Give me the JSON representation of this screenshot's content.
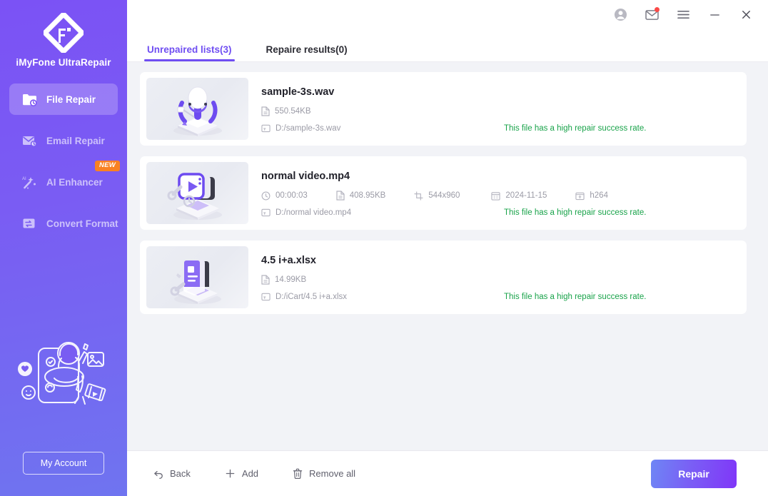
{
  "sidebar": {
    "brand": "iMyFone UltraRepair",
    "logo_icon": "diamond-logo-icon",
    "items": [
      {
        "label": "File Repair",
        "icon": "folder-repair-icon",
        "active": true,
        "badge": ""
      },
      {
        "label": "Email Repair",
        "icon": "mail-repair-icon",
        "active": false,
        "badge": ""
      },
      {
        "label": "AI Enhancer",
        "icon": "ai-wand-icon",
        "active": false,
        "badge": "NEW"
      },
      {
        "label": "Convert Format",
        "icon": "convert-icon",
        "active": false,
        "badge": ""
      }
    ],
    "account_button": "My Account",
    "illustration_icon": "person-photo-illustration"
  },
  "titlebar": {
    "buttons": [
      {
        "name": "account-icon",
        "glyph": "account"
      },
      {
        "name": "mail-icon",
        "glyph": "mail",
        "has_notification": true
      },
      {
        "name": "menu-icon",
        "glyph": "hamburger"
      },
      {
        "name": "minimize-icon",
        "glyph": "minimize"
      },
      {
        "name": "close-icon",
        "glyph": "close"
      }
    ]
  },
  "tabs": [
    {
      "label": "Unrepaired lists(3)",
      "active": true
    },
    {
      "label": "Repaire results(0)",
      "active": false
    }
  ],
  "files": [
    {
      "name": "sample-3s.wav",
      "thumb_icon": "microphone-3d-icon",
      "meta": [
        {
          "icon": "file-size-icon",
          "value": "550.54KB"
        }
      ],
      "path_icon": "folder-path-icon",
      "path": "D:/sample-3s.wav",
      "status": "This file has a high repair success rate."
    },
    {
      "name": "normal video.mp4",
      "thumb_icon": "video-player-3d-icon",
      "meta": [
        {
          "icon": "clock-icon",
          "value": "00:00:03"
        },
        {
          "icon": "file-size-icon",
          "value": "408.95KB"
        },
        {
          "icon": "resolution-icon",
          "value": "544x960"
        },
        {
          "icon": "calendar-icon",
          "value": "2024-11-15"
        },
        {
          "icon": "codec-icon",
          "value": "h264"
        }
      ],
      "path_icon": "folder-path-icon",
      "path": "D:/normal video.mp4",
      "status": "This file has a high repair success rate."
    },
    {
      "name": "4.5 i+a.xlsx",
      "thumb_icon": "document-3d-icon",
      "meta": [
        {
          "icon": "file-size-icon",
          "value": "14.99KB"
        }
      ],
      "path_icon": "folder-path-icon",
      "path": "D:/iCart/4.5 i+a.xlsx",
      "status": "This file has a high repair success rate."
    }
  ],
  "footer": {
    "back": "Back",
    "add": "Add",
    "remove_all": "Remove all",
    "repair": "Repair"
  },
  "colors": {
    "accent": "#6f4ef2",
    "sidebar_from": "#7b52f5",
    "sidebar_to": "#6f74f0",
    "success": "#19a34a",
    "badge_new": "#f98122",
    "background": "#f2f3f7",
    "card": "#ffffff",
    "notification_dot": "#fb4a48"
  }
}
